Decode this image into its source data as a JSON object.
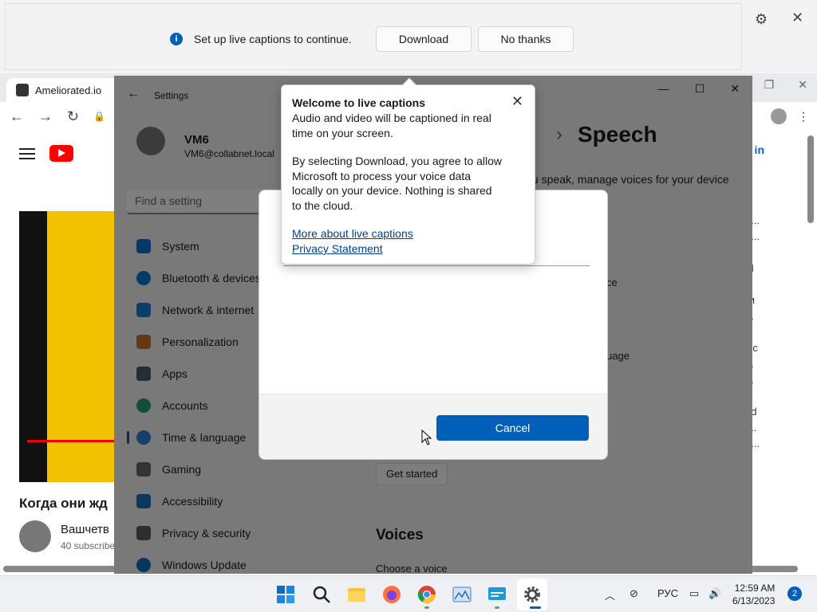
{
  "caption_bar": {
    "message": "Set up live captions to continue.",
    "download_label": "Download",
    "no_thanks_label": "No thanks",
    "info_glyph": "i",
    "settings_glyph": "⚙",
    "close_glyph": "✕"
  },
  "tooltip": {
    "title": "Welcome to live captions",
    "body1": "Audio and video will be captioned in real time on your screen.",
    "body2": "By selecting Download, you agree to allow Microsoft to process your voice data locally on your device. Nothing is shared to the cloud.",
    "link1": "More about live captions",
    "link2": "Privacy Statement",
    "close_glyph": "✕"
  },
  "dialog": {
    "cancel_label": "Cancel"
  },
  "chrome": {
    "tab_title": "Ameliorated.io",
    "signin": "Sign in",
    "video_title": "Когда они жд",
    "channel_name": "Вашчетв",
    "channel_subs": "40 subscribe",
    "back_glyph": "←",
    "forward_glyph": "→",
    "reload_glyph": "↻",
    "lock_glyph": "🔒",
    "menu_glyph": "⋮",
    "side_snippets": [
      "k",
      "o...",
      "n...",
      "M",
      "ы",
      "ги",
      "...",
      "sic",
      "...",
      "...",
      "ed",
      "I...",
      "2..."
    ]
  },
  "settings": {
    "title": "Settings",
    "user_name": "VM6",
    "user_email": "VM6@collabnet.local",
    "search_placeholder": "Find a setting",
    "breadcrumb_current": "Speech",
    "breadcrumb_prev": "e",
    "breadcrumb_sep": "›",
    "description": "u speak, manage voices for your device",
    "snippet1": "ce",
    "snippet2": "uage",
    "get_started": "Get started",
    "voices_heading": "Voices",
    "choose_voice": "Choose a voice",
    "nav": [
      {
        "label": "System",
        "icon": "system-icon",
        "color": "#0a6ed1"
      },
      {
        "label": "Bluetooth & devices",
        "icon": "bluetooth-icon",
        "color": "#0078d4"
      },
      {
        "label": "Network & internet",
        "icon": "network-icon",
        "color": "#1b7ccf"
      },
      {
        "label": "Personalization",
        "icon": "brush-icon",
        "color": "#c8702b"
      },
      {
        "label": "Apps",
        "icon": "apps-icon",
        "color": "#4a5a72"
      },
      {
        "label": "Accounts",
        "icon": "accounts-icon",
        "color": "#1f9e6e"
      },
      {
        "label": "Time & language",
        "icon": "globe-icon",
        "color": "#2a7fd4"
      },
      {
        "label": "Gaming",
        "icon": "gaming-icon",
        "color": "#666"
      },
      {
        "label": "Accessibility",
        "icon": "accessibility-icon",
        "color": "#1c6fc1"
      },
      {
        "label": "Privacy & security",
        "icon": "shield-icon",
        "color": "#5a5a5a"
      },
      {
        "label": "Windows Update",
        "icon": "update-icon",
        "color": "#0f6cbd"
      }
    ]
  },
  "taskbar": {
    "lang": "РУС",
    "time": "12:59 AM",
    "date": "6/13/2023",
    "notifications": "2",
    "icons": [
      "start-icon",
      "search-icon",
      "file-explorer-icon",
      "firefox-icon",
      "chrome-icon",
      "photos-icon",
      "remote-desktop-icon",
      "settings-icon"
    ]
  },
  "colors": {
    "accent": "#005fb8",
    "link": "#003e92"
  }
}
